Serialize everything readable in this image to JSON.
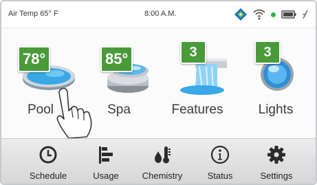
{
  "status_bar": {
    "air_temp": "Air Temp 65° F",
    "time": "8:00 A.M."
  },
  "tiles": [
    {
      "label": "Pool",
      "badge": "78°",
      "icon": "pool-icon"
    },
    {
      "label": "Spa",
      "badge": "85°",
      "icon": "spa-icon"
    },
    {
      "label": "Features",
      "badge": "3",
      "icon": "waterfall-icon"
    },
    {
      "label": "Lights",
      "badge": "3",
      "icon": "light-bulb-icon"
    }
  ],
  "nav": [
    {
      "label": "Schedule",
      "icon": "clock-icon"
    },
    {
      "label": "Usage",
      "icon": "bar-chart-icon"
    },
    {
      "label": "Chemistry",
      "icon": "drop-thermometer-icon"
    },
    {
      "label": "Status",
      "icon": "info-icon"
    },
    {
      "label": "Settings",
      "icon": "gear-icon"
    }
  ],
  "colors": {
    "badge": "#4a9a3a",
    "pool_water": "#3aa7e6",
    "wifi_dot": "#29b44a"
  }
}
